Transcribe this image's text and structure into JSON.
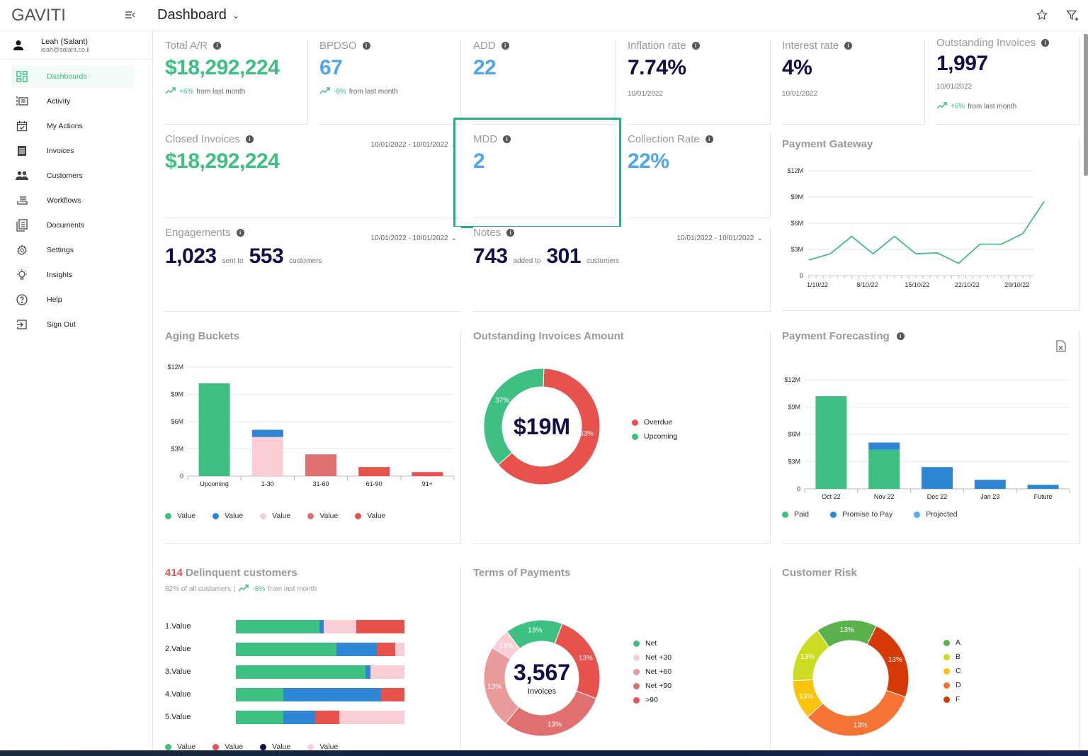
{
  "app": {
    "logo": "GAVITI",
    "title": "Dashboard"
  },
  "user": {
    "name": "Leah (Salant)",
    "email": "leah@salant.co.il"
  },
  "sidebar": {
    "items": [
      {
        "label": "Dashboards",
        "icon": "dashboard-icon",
        "active": true
      },
      {
        "label": "Activity",
        "icon": "activity-icon"
      },
      {
        "label": "My Actions",
        "icon": "calendar-check-icon"
      },
      {
        "label": "Invoices",
        "icon": "invoice-icon"
      },
      {
        "label": "Customers",
        "icon": "people-icon"
      },
      {
        "label": "Workflows",
        "icon": "workflow-icon"
      },
      {
        "label": "Documents",
        "icon": "documents-icon"
      },
      {
        "label": "Settings",
        "icon": "gear-icon"
      },
      {
        "label": "Insights",
        "icon": "lightbulb-icon"
      },
      {
        "label": "Help",
        "icon": "help-icon"
      },
      {
        "label": "Sign Out",
        "icon": "sign-out-icon"
      }
    ]
  },
  "kpis": {
    "total_ar": {
      "label": "Total A/R",
      "value": "$18,292,224",
      "change": "+6%",
      "change_text": "from last month"
    },
    "bpdso": {
      "label": "BPDSO",
      "value": "67",
      "change": "-8%",
      "change_text": "from last month"
    },
    "add": {
      "label": "ADD",
      "value": "22"
    },
    "inflation": {
      "label": "Inflation rate",
      "value": "7.74%",
      "date": "10/01/2022"
    },
    "interest": {
      "label": "Interest rate",
      "value": "4%",
      "date": "10/01/2022"
    },
    "outstanding": {
      "label": "Outstanding Invoices",
      "value": "1,997",
      "date": "10/01/2022",
      "change": "+6%",
      "change_text": "from last month"
    },
    "closed": {
      "label": "Closed Invoices",
      "value": "$18,292,224",
      "range": "10/01/2022 - 10/01/2022"
    },
    "mdd": {
      "label": "MDD",
      "value": "2"
    },
    "collection": {
      "label": "Collection Rate",
      "value": "22%"
    },
    "engagements": {
      "label": "Engagements",
      "range": "10/01/2022 - 10/01/2022",
      "count": "1,023",
      "mid": "sent to",
      "customers": "553",
      "suffix": "customers"
    },
    "notes": {
      "label": "Notes",
      "range": "10/01/2022 - 10/01/2022",
      "count": "743",
      "mid": "added to",
      "customers": "301",
      "suffix": "customers"
    }
  },
  "delinquent": {
    "count": "414",
    "title": "Delinquent customers",
    "share": "82% of all customers",
    "change": "-8%",
    "change_text": "from last month"
  },
  "chart_data": [
    {
      "id": "payment_gateway",
      "type": "line",
      "title": "Payment  Gateway",
      "ylim": [
        0,
        12
      ],
      "yticks": [
        "0",
        "$3M",
        "$6M",
        "$9M",
        "$12M"
      ],
      "ytick_values": [
        0,
        3,
        6,
        9,
        12
      ],
      "xlabels": [
        "1/10/22",
        "8/10/22",
        "15/10/22",
        "22/10/22",
        "29/10/22"
      ],
      "x": [
        0,
        3,
        6,
        9,
        12,
        15,
        18,
        21,
        24,
        27,
        30,
        32,
        35
      ],
      "values": [
        1.8,
        2.5,
        4.5,
        2.5,
        4.5,
        2.5,
        2.6,
        1.4,
        3.6,
        3.6,
        4.8,
        8.5
      ],
      "color": "#3dc081"
    },
    {
      "id": "aging_buckets",
      "type": "bar",
      "title": "Aging Buckets",
      "ylim": [
        0,
        12
      ],
      "yticks": [
        "0",
        "$3M",
        "$6M",
        "$9M",
        "$12M"
      ],
      "ytick_values": [
        0,
        3,
        6,
        9,
        12
      ],
      "categories": [
        "Upcoming",
        "1-30",
        "31-60",
        "61-90",
        "91+"
      ],
      "series": [
        {
          "name": "Value",
          "color": "#3dc081",
          "values": [
            10.2,
            0,
            0,
            0,
            0
          ]
        },
        {
          "name": "Value",
          "color": "#fbcdd4",
          "values": [
            0,
            4.3,
            0,
            0,
            0
          ]
        },
        {
          "name": "Value",
          "color": "#2e86d4",
          "values": [
            0,
            0.8,
            0,
            0,
            0
          ]
        },
        {
          "name": "Value",
          "color": "#e07070",
          "values": [
            0,
            0,
            2.4,
            0,
            0
          ]
        },
        {
          "name": "Value",
          "color": "#e8524d",
          "values": [
            0,
            0,
            0,
            1.0,
            0.45
          ]
        }
      ],
      "legend": [
        {
          "label": "Value",
          "color": "#3dc081"
        },
        {
          "label": "Value",
          "color": "#2e86d4"
        },
        {
          "label": "Value",
          "color": "#fbcdd4"
        },
        {
          "label": "Value",
          "color": "#e07070"
        },
        {
          "label": "Value",
          "color": "#e8524d"
        }
      ]
    },
    {
      "id": "outstanding_amount",
      "type": "pie",
      "title": "Outstanding Invoices Amount",
      "center": "$19M",
      "slices": [
        {
          "label": "Overdue",
          "value": 63,
          "text": "63%",
          "color": "#e8524d"
        },
        {
          "label": "Upcoming",
          "value": 37,
          "text": "37%",
          "color": "#3dc081"
        }
      ]
    },
    {
      "id": "payment_forecasting",
      "type": "bar",
      "title": "Payment Forecasting",
      "ylim": [
        0,
        12
      ],
      "yticks": [
        "0",
        "$3M",
        "$6M",
        "$9M",
        "$12M"
      ],
      "ytick_values": [
        0,
        3,
        6,
        9,
        12
      ],
      "categories": [
        "Oct 22",
        "Nov 22",
        "Dec 22",
        "Jan 23",
        "Future"
      ],
      "series": [
        {
          "name": "Paid",
          "color": "#3dc081",
          "values": [
            10.2,
            4.3,
            0,
            0,
            0
          ]
        },
        {
          "name": "Promise to Pay",
          "color": "#2e86d4",
          "values": [
            0,
            0.8,
            2.4,
            1.0,
            0.45
          ]
        },
        {
          "name": "Projected",
          "color": "#5aaaf5",
          "values": [
            0,
            0,
            0,
            0,
            0
          ]
        }
      ]
    },
    {
      "id": "delinquent_customers",
      "type": "bar",
      "orientation": "horizontal",
      "categories": [
        "1.Value",
        "2.Value",
        "3.Value",
        "4.Value",
        "5.Value"
      ],
      "rows": [
        [
          {
            "color": "#3dc081",
            "value": 49.5
          },
          {
            "color": "#2e86d4",
            "value": 2.5
          },
          {
            "color": "#fbcdd4",
            "value": 19.5
          },
          {
            "color": "#e8524d",
            "value": 28.5
          }
        ],
        [
          {
            "color": "#3dc081",
            "value": 59.5
          },
          {
            "color": "#2e86d4",
            "value": 24
          },
          {
            "color": "#e8524d",
            "value": 11
          },
          {
            "color": "#fbcdd4",
            "value": 5.5
          }
        ],
        [
          {
            "color": "#3dc081",
            "value": 77
          },
          {
            "color": "#2e86d4",
            "value": 3
          },
          {
            "color": "#fbcdd4",
            "value": 20
          }
        ],
        [
          {
            "color": "#3dc081",
            "value": 28
          },
          {
            "color": "#2e86d4",
            "value": 58
          },
          {
            "color": "#e8524d",
            "value": 14
          }
        ],
        [
          {
            "color": "#3dc081",
            "value": 28
          },
          {
            "color": "#2e86d4",
            "value": 19
          },
          {
            "color": "#e8524d",
            "value": 14.5
          },
          {
            "color": "#fbcdd4",
            "value": 38.5
          }
        ]
      ],
      "legend": [
        {
          "label": "Value",
          "color": "#3dc081"
        },
        {
          "label": "Value",
          "color": "#e8524d"
        },
        {
          "label": "Value",
          "color": "#120e4a"
        },
        {
          "label": "Value",
          "color": "#fbcdd4"
        }
      ]
    },
    {
      "id": "terms_of_payments",
      "type": "pie",
      "title": "Terms of Payments",
      "center": "3,567",
      "center_sub": "Invoices",
      "slices": [
        {
          "label": "Net",
          "value": 13,
          "weight": 16,
          "text": "13%",
          "color": "#3dc081"
        },
        {
          "label": ">90",
          "value": 13,
          "weight": 25,
          "text": "13%",
          "color": "#e8524d"
        },
        {
          "label": "Net +90",
          "value": 13,
          "weight": 30,
          "text": "13%",
          "color": "#e07070"
        },
        {
          "label": "Net +60",
          "value": 13,
          "weight": 23,
          "text": "13%",
          "color": "#e99a9a"
        },
        {
          "label": "Net +30",
          "value": 13,
          "weight": 6,
          "text": "13%",
          "color": "#fbcdd4"
        }
      ],
      "legend": [
        {
          "label": "Net",
          "color": "#3dc081"
        },
        {
          "label": "Net +30",
          "color": "#fbcdd4"
        },
        {
          "label": "Net +60",
          "color": "#e99a9a"
        },
        {
          "label": "Net +90",
          "color": "#e07070"
        },
        {
          "label": ">90",
          "color": "#e8524d"
        }
      ]
    },
    {
      "id": "customer_risk",
      "type": "pie",
      "title": "Customer Risk",
      "slices": [
        {
          "label": "A",
          "value": 13,
          "weight": 17,
          "text": "13%",
          "color": "#5bb14c"
        },
        {
          "label": "F",
          "value": 13,
          "weight": 23,
          "text": "13%",
          "color": "#d63a07"
        },
        {
          "label": "D",
          "value": 13,
          "weight": 33,
          "text": "13%",
          "color": "#f57433"
        },
        {
          "label": "C",
          "value": 13,
          "weight": 11,
          "text": "13%",
          "color": "#f9c40a"
        },
        {
          "label": "B",
          "value": 13,
          "weight": 16,
          "text": "13%",
          "color": "#cddc22"
        }
      ],
      "legend": [
        {
          "label": "A",
          "color": "#5bb14c"
        },
        {
          "label": "B",
          "color": "#cddc22"
        },
        {
          "label": "C",
          "color": "#f9c40a"
        },
        {
          "label": "D",
          "color": "#f57433"
        },
        {
          "label": "F",
          "color": "#d63a07"
        }
      ]
    }
  ]
}
